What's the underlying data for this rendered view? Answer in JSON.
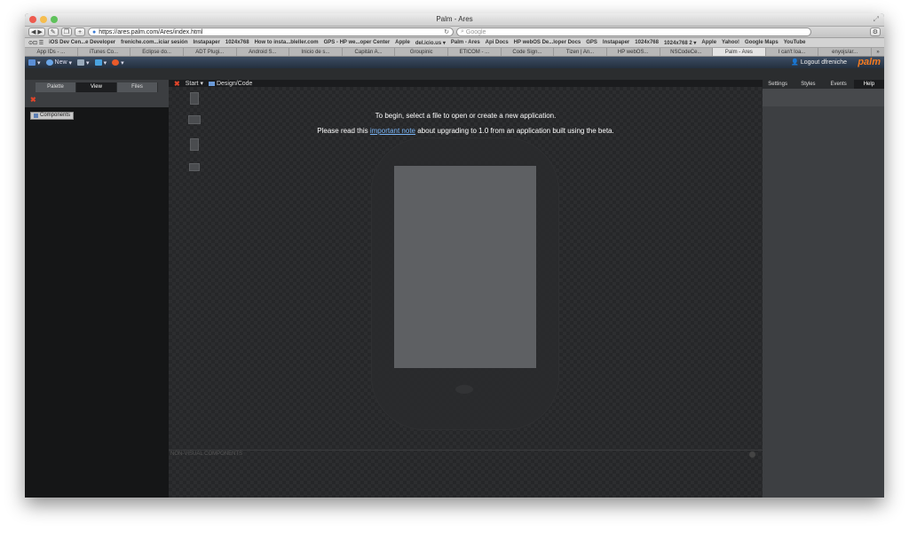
{
  "window": {
    "title": "Palm - Ares"
  },
  "browser": {
    "url": "https://ares.palm.com/Ares/index.html",
    "search_placeholder": "Google",
    "bookmarks": [
      "iOS Dev Cen...e Developer",
      "freniche.com...iciar sesión",
      "Instapaper",
      "1024x768",
      "How to insta...bleller.com",
      "GPS - HP we...oper Center",
      "Apple",
      "del.icio.us ▾",
      "Palm - Ares",
      "Api Docs",
      "HP webOS De...loper Docs",
      "GPS",
      "Instapaper",
      "1024x768",
      "1024x768 2 ▾",
      "Apple",
      "Yahoo!",
      "Google Maps",
      "YouTube"
    ],
    "tabs": [
      "App IDs - ...",
      "iTunes Co...",
      "Eclipse do...",
      "ADT Plugi...",
      "Android S...",
      "Inicio de s...",
      "Capitán A...",
      "Groupinic",
      "ETICOM - ...",
      "Code Sign...",
      "Tizen | An...",
      "HP webOS...",
      "NSCodeCe...",
      "Palm - Ares",
      "I can't loa...",
      "enyojs/ar..."
    ],
    "active_tab_index": 13
  },
  "ares_toolbar": {
    "new_label": "New",
    "logout_label": "Logout dfreniche",
    "logo_text": "palm"
  },
  "left_panel": {
    "tabs": [
      "Palette",
      "View",
      "Files"
    ],
    "active_tab_index": 1,
    "tree_item": "Components"
  },
  "center": {
    "start_label": "Start",
    "design_code_label": "Design/Code",
    "message_line1": "To begin, select a file to open or create a new application.",
    "message_line2_prefix": "Please read this ",
    "message_link": "important note",
    "message_line2_suffix": " about upgrading to 1.0 from an application built using the beta.",
    "nonvisual_label": "NON-VISUAL COMPONENTS"
  },
  "right_panel": {
    "tabs": [
      "Settings",
      "Styles",
      "Events",
      "Help"
    ],
    "active_tab_index": 3
  },
  "colors": {
    "accent_logo": "#f47b20",
    "close_red": "#e2452a",
    "link_blue": "#79b4f5"
  }
}
